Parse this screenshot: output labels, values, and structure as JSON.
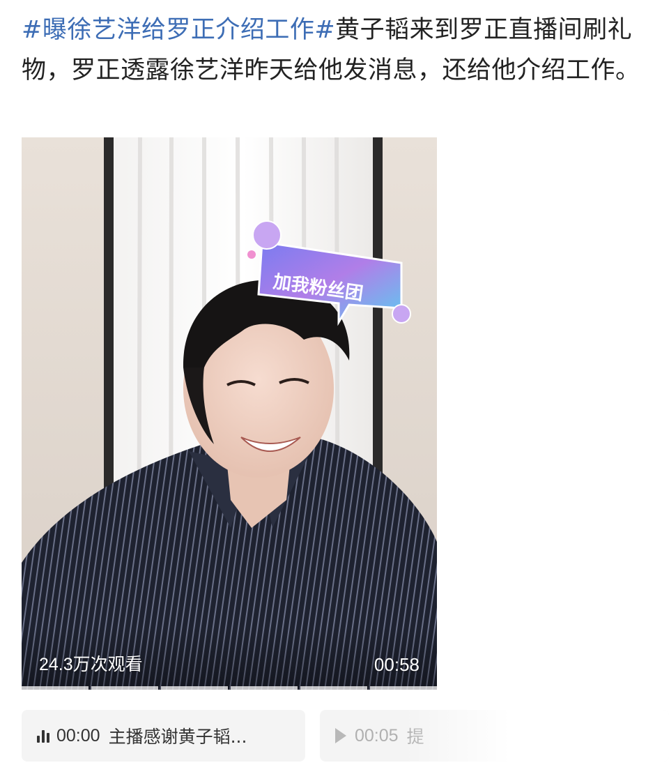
{
  "post": {
    "hashtag": "#曝徐艺洋给罗正介绍工作#",
    "body": "黄子韬来到罗正直播间刷礼物，罗正透露徐艺洋昨天给他发消息，还给他介绍工作。"
  },
  "video": {
    "badge_text": "加我粉丝团",
    "view_count": "24.3万次观看",
    "duration": "00:58",
    "progress_segments": 6
  },
  "chapters": [
    {
      "icon": "audio-bars-icon",
      "time": "00:00",
      "title": "主播感谢黄子韬..."
    },
    {
      "icon": "play-icon",
      "time": "00:05",
      "title": "提"
    }
  ],
  "colors": {
    "hashtag": "#3d6db5",
    "text": "#222222",
    "chapter_bg": "#f4f4f4"
  }
}
